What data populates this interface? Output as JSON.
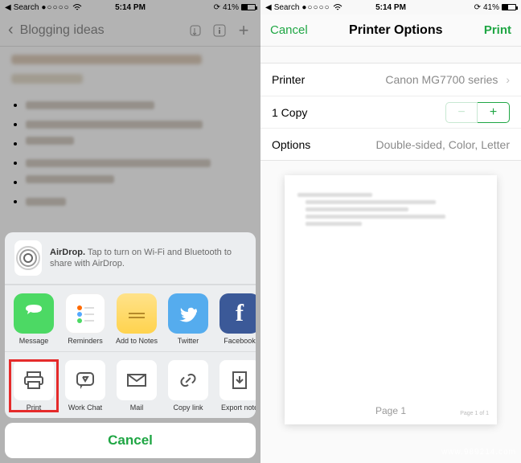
{
  "statusbar": {
    "back_to_app": "Search",
    "time": "5:14 PM",
    "battery_pct": "41%"
  },
  "left": {
    "nav_title": "Blogging ideas",
    "airdrop_label": "AirDrop.",
    "airdrop_hint": "Tap to turn on Wi-Fi and Bluetooth to share with AirDrop.",
    "apps": [
      {
        "name": "Message"
      },
      {
        "name": "Reminders"
      },
      {
        "name": "Add to Notes"
      },
      {
        "name": "Twitter"
      },
      {
        "name": "Facebook"
      }
    ],
    "actions": [
      {
        "name": "Print"
      },
      {
        "name": "Work Chat"
      },
      {
        "name": "Mail"
      },
      {
        "name": "Copy link"
      },
      {
        "name": "Export note"
      }
    ],
    "cancel": "Cancel"
  },
  "right": {
    "nav_cancel": "Cancel",
    "nav_title": "Printer Options",
    "nav_print": "Print",
    "rows": {
      "printer_label": "Printer",
      "printer_value": "Canon MG7700 series",
      "copies_label": "1 Copy",
      "options_label": "Options",
      "options_value": "Double-sided, Color, Letter"
    },
    "preview": {
      "page_label": "Page 1",
      "footer": "Page 1 of 1"
    }
  },
  "watermark": "www.989214.com"
}
